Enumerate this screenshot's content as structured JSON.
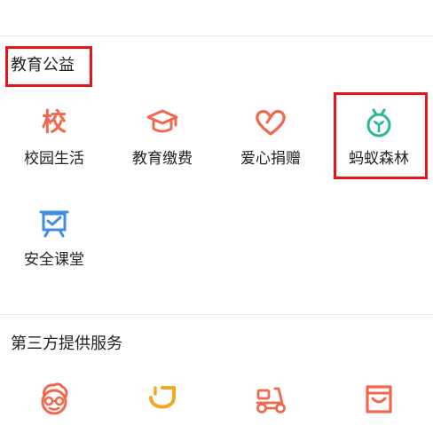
{
  "sections": {
    "education": {
      "title": "教育公益",
      "items": [
        {
          "label": "校园生活",
          "icon": "school-character-icon"
        },
        {
          "label": "教育缴费",
          "icon": "graduation-cap-icon"
        },
        {
          "label": "爱心捐赠",
          "icon": "heart-icon"
        },
        {
          "label": "蚂蚁森林",
          "icon": "sprout-icon"
        },
        {
          "label": "安全课堂",
          "icon": "presentation-board-icon"
        }
      ],
      "school_glyph": "校"
    },
    "third_party": {
      "title": "第三方提供服务",
      "items": [
        {
          "icon": "cartoon-face-icon"
        },
        {
          "icon": "didi-d-icon"
        },
        {
          "icon": "scooter-icon"
        },
        {
          "icon": "shopping-bag-icon"
        }
      ]
    }
  },
  "colors": {
    "accent_orange": "#f0694e",
    "forest_green": "#2bb79a",
    "blue": "#3e8bea",
    "didi_orange": "#f5a623",
    "highlight_red": "#e6141b"
  }
}
